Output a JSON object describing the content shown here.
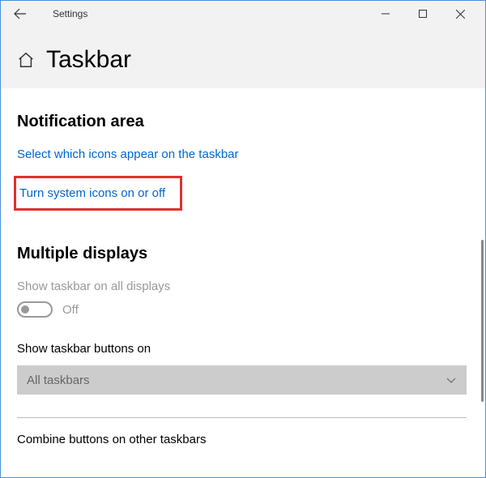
{
  "titlebar": {
    "title": "Settings"
  },
  "header": {
    "page_title": "Taskbar"
  },
  "sections": {
    "notification_area": {
      "title": "Notification area",
      "link_select_icons": "Select which icons appear on the taskbar",
      "link_system_icons": "Turn system icons on or off"
    },
    "multiple_displays": {
      "title": "Multiple displays",
      "show_all_displays_label": "Show taskbar on all displays",
      "show_all_displays_state": "Off",
      "show_buttons_label": "Show taskbar buttons on",
      "show_buttons_value": "All taskbars",
      "combine_label": "Combine buttons on other taskbars"
    }
  }
}
